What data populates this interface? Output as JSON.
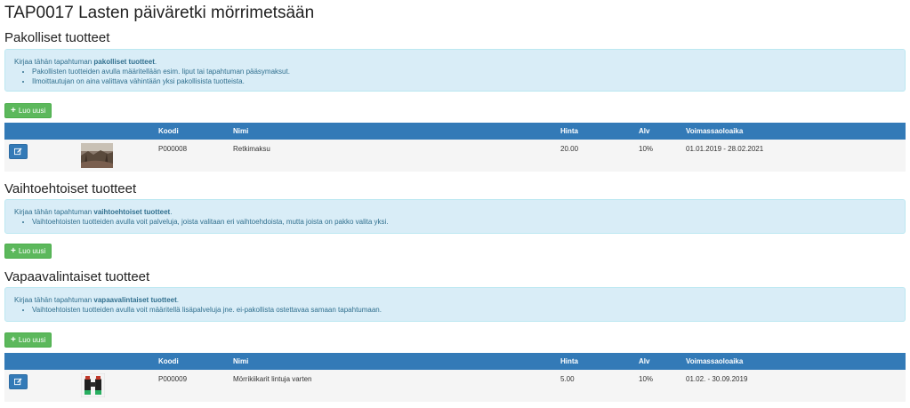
{
  "page_title": "TAP0017 Lasten päiväretki mörrimetsään",
  "colors": {
    "primary": "#337ab7",
    "success": "#5cb85c",
    "info_bg": "#d9edf7",
    "info_text": "#31708f"
  },
  "sections": [
    {
      "heading": "Pakolliset tuotteet",
      "info": {
        "intro_prefix": "Kirjaa tähän tapahtuman ",
        "intro_bold": "pakolliset tuotteet",
        "intro_suffix": ".",
        "bullets": [
          "Pakollisten tuotteiden avulla määritellään esim. liput tai tapahtuman pääsymaksut.",
          "Ilmoittautujan on aina valittava vähintään yksi pakollisista tuotteista."
        ]
      },
      "new_button": "Luo uusi",
      "table": {
        "headers": [
          "Koodi",
          "Nimi",
          "Hinta",
          "Alv",
          "Voimassaoloaika"
        ],
        "rows": [
          {
            "code": "P000008",
            "name": "Retkimaksu",
            "price": "20.00",
            "vat": "10%",
            "validity": "01.01.2019 - 28.02.2021",
            "image": "forest-photo"
          }
        ]
      }
    },
    {
      "heading": "Vaihtoehtoiset tuotteet",
      "info": {
        "intro_prefix": "Kirjaa tähän tapahtuman ",
        "intro_bold": "vaihtoehtoiset tuotteet",
        "intro_suffix": ".",
        "bullets": [
          "Vaihtoehtoisten tuotteiden avulla voit palveluja, joista valitaan eri vaihtoehdoista, mutta joista on pakko valita yksi."
        ]
      },
      "new_button": "Luo uusi"
    },
    {
      "heading": "Vapaavalintaiset tuotteet",
      "info": {
        "intro_prefix": "Kirjaa tähän tapahtuman ",
        "intro_bold": "vapaavalintaiset tuotteet",
        "intro_suffix": ".",
        "bullets": [
          "Vaihtoehtoisten tuotteiden avulla voit määritellä lisäpalveluja jne. ei-pakollista ostettavaa samaan tapahtumaan."
        ]
      },
      "new_button": "Luo uusi",
      "table": {
        "headers": [
          "Koodi",
          "Nimi",
          "Hinta",
          "Alv",
          "Voimassaoloaika"
        ],
        "rows": [
          {
            "code": "P000009",
            "name": "Mörrikiikarit lintuja varten",
            "price": "5.00",
            "vat": "10%",
            "validity": "01.02. - 30.09.2019",
            "image": "binoculars-photo"
          }
        ]
      }
    }
  ]
}
